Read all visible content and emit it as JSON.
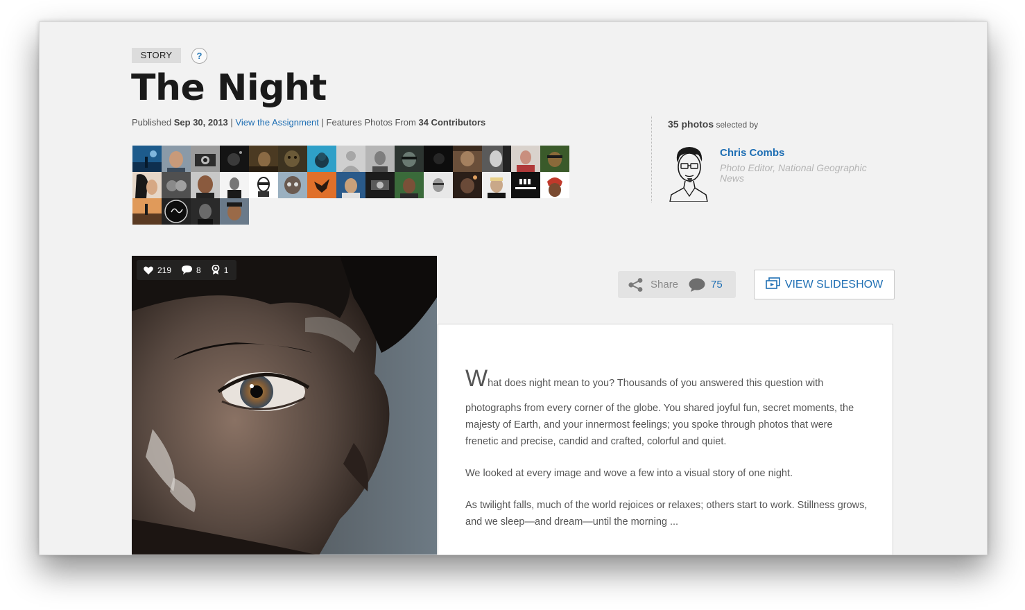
{
  "header": {
    "tag": "STORY",
    "help": "?",
    "title": "The Night",
    "published_label": "Published",
    "published_date": "Sep 30, 2013",
    "sep1": "|",
    "assignment_link": "View the Assignment",
    "sep2": "|",
    "features_text": "Features Photos From",
    "contributors_count": "34 Contributors"
  },
  "curator": {
    "photos_count": "35 photos",
    "selected_by": "selected by",
    "name": "Chris Combs",
    "role": "Photo Editor, National Geographic News"
  },
  "hero": {
    "likes": "219",
    "comments": "8",
    "awards": "1"
  },
  "actions": {
    "share_label": "Share",
    "comment_count": "75",
    "slideshow_label": "VIEW SLIDESHOW"
  },
  "story": {
    "drop_cap": "W",
    "lead_first": "hat does night mean to you? Thousands of you answered this question with",
    "lead_rest": "photographs from every corner of the globe. You shared joyful fun, secret moments, the majesty of Earth, and your innermost feelings; you spoke through photos that were frenetic and precise, candid and crafted, colorful and quiet.",
    "p2": "We looked at every image and wove a few into a visual story of one night.",
    "p3": "As twilight falls, much of the world rejoices or relaxes; others start to work. Stillness grows, and we sleep—and dream—until the morning ..."
  },
  "colors": {
    "link": "#1f6fb4",
    "background": "#f2f2f2"
  }
}
